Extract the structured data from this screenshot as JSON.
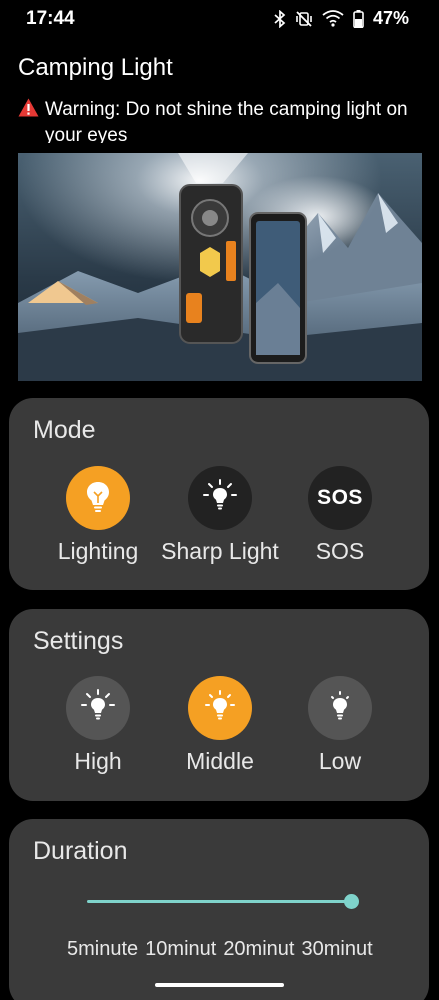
{
  "status_bar": {
    "time": "17:44",
    "battery": "47%",
    "icons": [
      "bluetooth-icon",
      "vibrate-off-icon",
      "wifi-icon",
      "battery-icon"
    ]
  },
  "page": {
    "title": "Camping Light",
    "warning": "Warning: Do not shine the camping light on your eyes"
  },
  "mode": {
    "title": "Mode",
    "options": [
      {
        "label": "Lighting",
        "icon": "bulb-icon",
        "selected": true
      },
      {
        "label": "Sharp Light",
        "icon": "bright-bulb-icon",
        "selected": false
      },
      {
        "label": "SOS",
        "icon": "sos-icon",
        "selected": false
      }
    ]
  },
  "settings": {
    "title": "Settings",
    "options": [
      {
        "label": "High",
        "icon": "bulb-high-icon",
        "selected": false
      },
      {
        "label": "Middle",
        "icon": "bulb-middle-icon",
        "selected": true
      },
      {
        "label": "Low",
        "icon": "bulb-low-icon",
        "selected": false
      }
    ]
  },
  "duration": {
    "title": "Duration",
    "ticks": [
      "5minute",
      "10minut",
      "20minut",
      "30minut"
    ],
    "selected_index": 3
  },
  "colors": {
    "accent": "#f5a023",
    "card": "#3a3a3a",
    "slider": "#7fd3cb"
  }
}
